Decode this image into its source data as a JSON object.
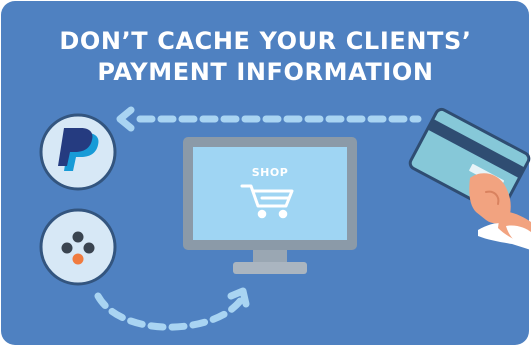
{
  "headline": {
    "line1": "DON’T CACHE YOUR CLIENTS’",
    "line2": "PAYMENT INFORMATION"
  },
  "monitor": {
    "screen_label": "SHOP",
    "icon": "shopping-cart-icon"
  },
  "payment_options": [
    {
      "icon": "paypal-icon"
    },
    {
      "icon": "dots-logo-icon"
    }
  ],
  "card": {
    "icon": "credit-card-icon",
    "holder": "hand-icon"
  },
  "colors": {
    "background": "#4f81c1",
    "dashed_arrow": "#a9d4f2",
    "screen": "#9fd5f3",
    "monitor_frame": "#8b9aa8",
    "card": "#86c8d8",
    "paypal_dark": "#253b80",
    "paypal_light": "#179bd7",
    "accent_orange": "#f07b3f"
  }
}
